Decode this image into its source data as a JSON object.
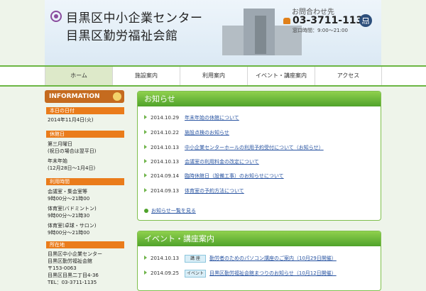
{
  "header": {
    "title_line1": "目黒区中小企業センター",
    "title_line2": "目黒区勤労福祉会館",
    "contact_label": "お問合わせ先",
    "phone": "03-3711-1135",
    "hours": "窓口時間：9:00〜21:00",
    "mail_label": "mail"
  },
  "nav": [
    "ホーム",
    "施設案内",
    "利用案内",
    "イベント・講座案内",
    "アクセス"
  ],
  "sidebar": {
    "title": "INFORMATION",
    "sections": [
      {
        "label": "本日の日付",
        "lines": [
          "2014年11月4日(火)"
        ]
      },
      {
        "label": "休館日",
        "lines": [
          "第三月曜日",
          "(祝日の場合は翌平日)",
          "年末年始",
          "(12月28日〜1月4日)"
        ]
      },
      {
        "label": "利用時間",
        "lines": [
          "会議室・集会室等",
          "9時00分〜21時00",
          "体育室(バドミントン)",
          "9時00分〜21時30",
          "体育室(卓球・サロン)",
          "9時00分〜21時00"
        ]
      },
      {
        "label": "所在地",
        "lines": [
          "目黒区中小企業センター",
          "目黒区勤労福祉会館",
          "〒153-0063",
          "目黒区目黒二丁目4-36",
          "TEL：03-3711-1135"
        ]
      }
    ]
  },
  "news": {
    "title": "お知らせ",
    "items": [
      {
        "date": "2014.10.29",
        "text": "年末年始の休館について"
      },
      {
        "date": "2014.10.22",
        "text": "施設点検のお知らせ"
      },
      {
        "date": "2014.10.13",
        "text": "中小企業センターホールの利用予約受付について（お知らせ）"
      },
      {
        "date": "2014.10.13",
        "text": "会議室の利用料金の改定について"
      },
      {
        "date": "2014.09.14",
        "text": "臨時休館日（設備工事）のお知らせについて"
      },
      {
        "date": "2014.09.13",
        "text": "体育室の予約方法について"
      }
    ],
    "more": "お知らせ一覧を見る"
  },
  "events": {
    "title": "イベント・講座案内",
    "items": [
      {
        "date": "2014.10.13",
        "badge": "講 座",
        "text": "勤労者のためのパソコン講座のご案内（10月29日開催）"
      },
      {
        "date": "2014.09.25",
        "badge": "イベント",
        "text": "目黒区勤労福祉会館まつりのお知らせ（10月12日開催）"
      }
    ]
  }
}
